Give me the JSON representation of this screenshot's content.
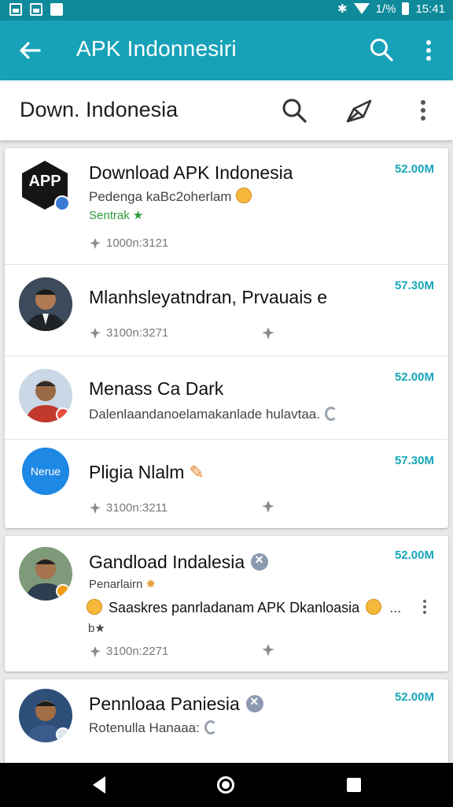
{
  "status_bar": {
    "time": "15:41",
    "signal_text": "1/%"
  },
  "app_bar": {
    "title": "APK Indonnesiri"
  },
  "sub_bar": {
    "title": "Down. Indonesia"
  },
  "colors": {
    "primary": "#17a2b8",
    "status": "#0e8a9b",
    "price": "#16a7b8",
    "green": "#2e9a3a"
  },
  "card1": {
    "items": [
      {
        "name": "Download APK Indonesia",
        "subtitle": "Pedenga kaBc2oherlam",
        "tag": "Sentrak ★",
        "meta": "1000n:3121",
        "price": "52.00M",
        "avatar_text": "APP"
      },
      {
        "name": "Mlanhsleyatndran, Prvauais e",
        "meta": "3100n:3271",
        "price": "57.30M"
      },
      {
        "name": "Menass Ca Dark",
        "subtitle": "Dalenlaandanoelamakanlade hulavtaa.",
        "price": "52.00M"
      },
      {
        "name": "Pligia Nlalm",
        "meta": "3100n:3211",
        "price": "57.30M",
        "avatar_text": "Nerue"
      }
    ]
  },
  "card2": {
    "name": "Gandload Indalesia",
    "subtitle": "Penarlairn",
    "message": "Saaskres panrladanam APK Dkanloasia",
    "tail": "b★",
    "meta": "3100n:2271",
    "price": "52.00M"
  },
  "card3": {
    "name": "Pennloaa Paniesia",
    "subtitle": "Rotenulla Hanaaa:",
    "price": "52.00M"
  }
}
